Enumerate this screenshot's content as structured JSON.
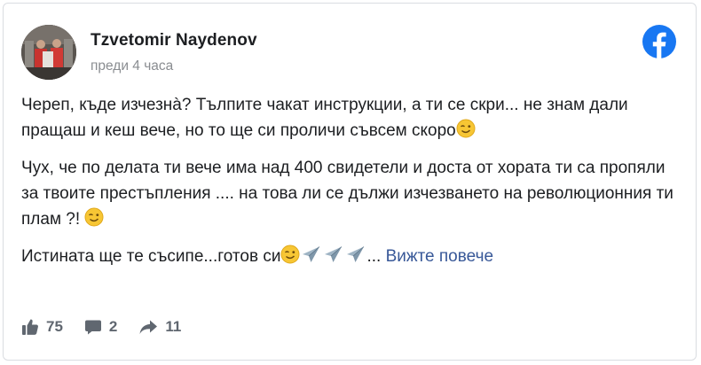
{
  "post": {
    "author": "Tzvetomir Naydenov",
    "timestamp": "преди 4 часа",
    "paragraphs": {
      "p1_text": "Череп, къде изчезнà? Тълпите чакат инструкции, а ти се скри... не знам дали пращаш и кеш вече, но то ще си проличи съвсем скоро",
      "p2_text": "Чух, че по делата ти вече има над 400 свидетели и доста от хората ти са пропяли за твоите престъпления .... на това ли се дължи изчезването на революционния ти плам ?! ",
      "p3_text": "Истината ще те съсипе...готов си",
      "p3_ellipsis": "... ",
      "see_more": "Вижте повече"
    },
    "icons": {
      "logo": "facebook-logo-icon",
      "wink": "winking-face-emoji",
      "plane": "airplane-emoji"
    },
    "stats": {
      "likes": "75",
      "comments": "2",
      "shares": "11"
    },
    "colors": {
      "facebook_blue": "#1877f2",
      "link": "#385898",
      "text": "#1c1e21",
      "muted": "#606770"
    }
  }
}
